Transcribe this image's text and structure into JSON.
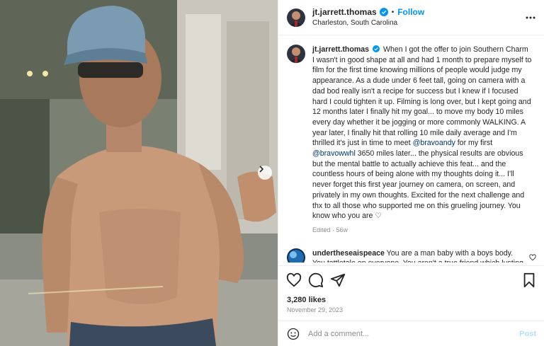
{
  "header": {
    "username": "jt.jarrett.thomas",
    "dot": "•",
    "follow_label": "Follow",
    "location": "Charleston, South Carolina"
  },
  "caption": {
    "username": "jt.jarrett.thomas",
    "part1": "When I got the offer to join Southern Charm I wasn't in good shape at all and had 1 month to prepare myself to film for the first time knowing millions of people would judge my appearance. As a dude under 6 feet tall, going on camera with a dad bod really isn't a recipe for success but I knew if I focused hard I could tighten it up. Filming is long over, but I kept going and 12 months later I finally hit my goal... to move my body 10 miles every day whether it be jogging or more commonly WALKING. A year later, I finally hit that rolling 10 mile daily average and I'm thrilled it's just in time to meet ",
    "mention1": "@bravoandy",
    "part2": " for my first ",
    "mention2": "@bravowwhl",
    "part3": " 3650 miles later... the physical results are obvious but the mental battle to actually achieve this feat... and the countless hours of being alone with my thoughts doing it... I'll never forget this first year journey on camera, on screen, and privately in my own thoughts. Excited for the next challenge and thx to all those who supported me on this grueling journey. You know who you are ♡",
    "meta": "Edited · 56w"
  },
  "comments": [
    {
      "username": "undertheseaispeace",
      "text": "You are a man baby with a boys body. You tattletale on everyone. You aren't a true friend which lusting over Taylor. You are way over Confident for no reason!!"
    }
  ],
  "likes": "3,280 likes",
  "date": "November 29, 2023",
  "add_comment": {
    "placeholder": "Add a comment...",
    "post_label": "Post"
  },
  "colors": {
    "accent": "#0095f6",
    "mention": "#00376b",
    "secondary_text": "#8e8e8e"
  },
  "icons": [
    "verified-badge-icon",
    "more-options-icon",
    "heart-icon",
    "comment-icon",
    "share-icon",
    "bookmark-icon",
    "emoji-icon",
    "chevron-right-icon"
  ]
}
